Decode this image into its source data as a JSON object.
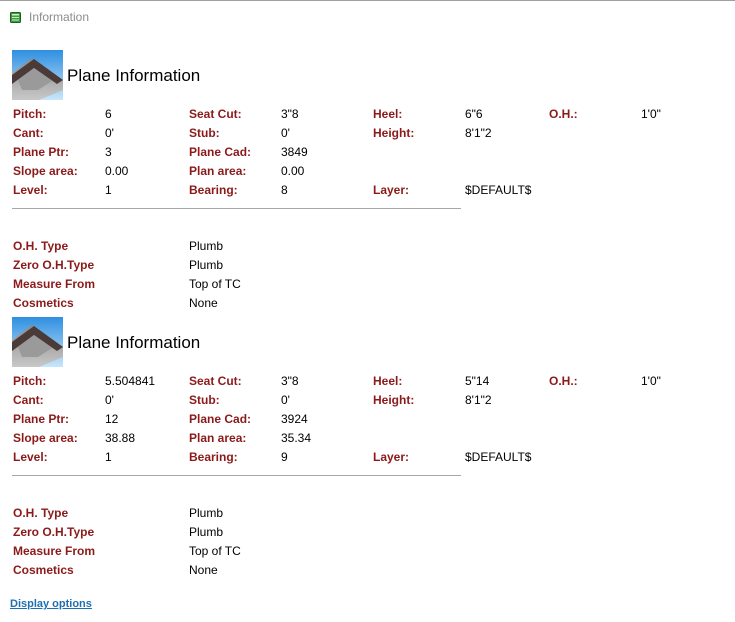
{
  "window": {
    "title": "Information",
    "icon": "green-book-icon"
  },
  "planes": [
    {
      "title": "Plane Information",
      "icon": "roof-plane-icon",
      "pitch_label": "Pitch:",
      "pitch": "6",
      "seatcut_label": "Seat Cut:",
      "seatcut": "3\"8",
      "heel_label": "Heel:",
      "heel": "6\"6",
      "oh_label": "O.H.:",
      "oh": "1'0\"",
      "cant_label": "Cant:",
      "cant": "0'",
      "stub_label": "Stub:",
      "stub": "0'",
      "height_label": "Height:",
      "height": "8'1\"2",
      "ptr_label": "Plane Ptr:",
      "ptr": "3",
      "cad_label": "Plane Cad:",
      "cad": "3849",
      "slope_label": "Slope area:",
      "slope": "0.00",
      "planarea_label": "Plan area:",
      "planarea": "0.00",
      "level_label": "Level:",
      "level": "1",
      "bearing_label": "Bearing:",
      "bearing": "8",
      "layer_label": "Layer:",
      "layer": "$DEFAULT$",
      "ohtype_label": "O.H. Type",
      "ohtype": "Plumb",
      "zero_label": "Zero O.H.Type",
      "zero": "Plumb",
      "measure_label": "Measure From",
      "measure": "Top of TC",
      "cosmetics_label": "Cosmetics",
      "cosmetics": "None"
    },
    {
      "title": "Plane Information",
      "icon": "roof-plane-icon",
      "pitch_label": "Pitch:",
      "pitch": "5.504841",
      "seatcut_label": "Seat Cut:",
      "seatcut": "3\"8",
      "heel_label": "Heel:",
      "heel": "5\"14",
      "oh_label": "O.H.:",
      "oh": "1'0\"",
      "cant_label": "Cant:",
      "cant": "0'",
      "stub_label": "Stub:",
      "stub": "0'",
      "height_label": "Height:",
      "height": "8'1\"2",
      "ptr_label": "Plane Ptr:",
      "ptr": "12",
      "cad_label": "Plane Cad:",
      "cad": "3924",
      "slope_label": "Slope area:",
      "slope": "38.88",
      "planarea_label": "Plan area:",
      "planarea": "35.34",
      "level_label": "Level:",
      "level": "1",
      "bearing_label": "Bearing:",
      "bearing": "9",
      "layer_label": "Layer:",
      "layer": "$DEFAULT$",
      "ohtype_label": "O.H. Type",
      "ohtype": "Plumb",
      "zero_label": "Zero O.H.Type",
      "zero": "Plumb",
      "measure_label": "Measure From",
      "measure": "Top of TC",
      "cosmetics_label": "Cosmetics",
      "cosmetics": "None"
    }
  ],
  "footer": {
    "display_options": "Display options"
  },
  "colors": {
    "label": "#8b1a1a",
    "link": "#1f6fb0",
    "header_text": "#8c8c8c"
  }
}
